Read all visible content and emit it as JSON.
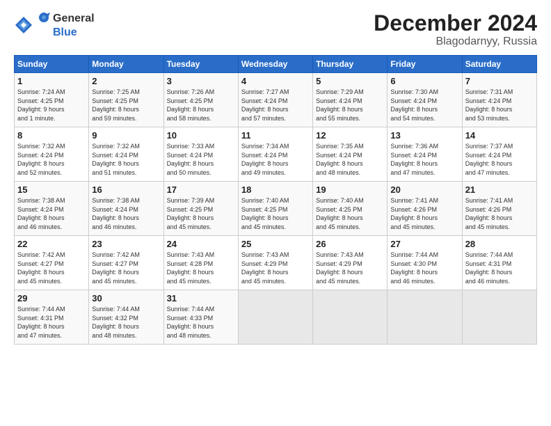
{
  "logo": {
    "general": "General",
    "blue": "Blue"
  },
  "title": "December 2024",
  "subtitle": "Blagodarnyy, Russia",
  "weekdays": [
    "Sunday",
    "Monday",
    "Tuesday",
    "Wednesday",
    "Thursday",
    "Friday",
    "Saturday"
  ],
  "weeks": [
    [
      {
        "day": "1",
        "info": "Sunrise: 7:24 AM\nSunset: 4:25 PM\nDaylight: 9 hours\nand 1 minute."
      },
      {
        "day": "2",
        "info": "Sunrise: 7:25 AM\nSunset: 4:25 PM\nDaylight: 8 hours\nand 59 minutes."
      },
      {
        "day": "3",
        "info": "Sunrise: 7:26 AM\nSunset: 4:25 PM\nDaylight: 8 hours\nand 58 minutes."
      },
      {
        "day": "4",
        "info": "Sunrise: 7:27 AM\nSunset: 4:24 PM\nDaylight: 8 hours\nand 57 minutes."
      },
      {
        "day": "5",
        "info": "Sunrise: 7:29 AM\nSunset: 4:24 PM\nDaylight: 8 hours\nand 55 minutes."
      },
      {
        "day": "6",
        "info": "Sunrise: 7:30 AM\nSunset: 4:24 PM\nDaylight: 8 hours\nand 54 minutes."
      },
      {
        "day": "7",
        "info": "Sunrise: 7:31 AM\nSunset: 4:24 PM\nDaylight: 8 hours\nand 53 minutes."
      }
    ],
    [
      {
        "day": "8",
        "info": "Sunrise: 7:32 AM\nSunset: 4:24 PM\nDaylight: 8 hours\nand 52 minutes."
      },
      {
        "day": "9",
        "info": "Sunrise: 7:32 AM\nSunset: 4:24 PM\nDaylight: 8 hours\nand 51 minutes."
      },
      {
        "day": "10",
        "info": "Sunrise: 7:33 AM\nSunset: 4:24 PM\nDaylight: 8 hours\nand 50 minutes."
      },
      {
        "day": "11",
        "info": "Sunrise: 7:34 AM\nSunset: 4:24 PM\nDaylight: 8 hours\nand 49 minutes."
      },
      {
        "day": "12",
        "info": "Sunrise: 7:35 AM\nSunset: 4:24 PM\nDaylight: 8 hours\nand 48 minutes."
      },
      {
        "day": "13",
        "info": "Sunrise: 7:36 AM\nSunset: 4:24 PM\nDaylight: 8 hours\nand 47 minutes."
      },
      {
        "day": "14",
        "info": "Sunrise: 7:37 AM\nSunset: 4:24 PM\nDaylight: 8 hours\nand 47 minutes."
      }
    ],
    [
      {
        "day": "15",
        "info": "Sunrise: 7:38 AM\nSunset: 4:24 PM\nDaylight: 8 hours\nand 46 minutes."
      },
      {
        "day": "16",
        "info": "Sunrise: 7:38 AM\nSunset: 4:24 PM\nDaylight: 8 hours\nand 46 minutes."
      },
      {
        "day": "17",
        "info": "Sunrise: 7:39 AM\nSunset: 4:25 PM\nDaylight: 8 hours\nand 45 minutes."
      },
      {
        "day": "18",
        "info": "Sunrise: 7:40 AM\nSunset: 4:25 PM\nDaylight: 8 hours\nand 45 minutes."
      },
      {
        "day": "19",
        "info": "Sunrise: 7:40 AM\nSunset: 4:25 PM\nDaylight: 8 hours\nand 45 minutes."
      },
      {
        "day": "20",
        "info": "Sunrise: 7:41 AM\nSunset: 4:26 PM\nDaylight: 8 hours\nand 45 minutes."
      },
      {
        "day": "21",
        "info": "Sunrise: 7:41 AM\nSunset: 4:26 PM\nDaylight: 8 hours\nand 45 minutes."
      }
    ],
    [
      {
        "day": "22",
        "info": "Sunrise: 7:42 AM\nSunset: 4:27 PM\nDaylight: 8 hours\nand 45 minutes."
      },
      {
        "day": "23",
        "info": "Sunrise: 7:42 AM\nSunset: 4:27 PM\nDaylight: 8 hours\nand 45 minutes."
      },
      {
        "day": "24",
        "info": "Sunrise: 7:43 AM\nSunset: 4:28 PM\nDaylight: 8 hours\nand 45 minutes."
      },
      {
        "day": "25",
        "info": "Sunrise: 7:43 AM\nSunset: 4:29 PM\nDaylight: 8 hours\nand 45 minutes."
      },
      {
        "day": "26",
        "info": "Sunrise: 7:43 AM\nSunset: 4:29 PM\nDaylight: 8 hours\nand 45 minutes."
      },
      {
        "day": "27",
        "info": "Sunrise: 7:44 AM\nSunset: 4:30 PM\nDaylight: 8 hours\nand 46 minutes."
      },
      {
        "day": "28",
        "info": "Sunrise: 7:44 AM\nSunset: 4:31 PM\nDaylight: 8 hours\nand 46 minutes."
      }
    ],
    [
      {
        "day": "29",
        "info": "Sunrise: 7:44 AM\nSunset: 4:31 PM\nDaylight: 8 hours\nand 47 minutes."
      },
      {
        "day": "30",
        "info": "Sunrise: 7:44 AM\nSunset: 4:32 PM\nDaylight: 8 hours\nand 48 minutes."
      },
      {
        "day": "31",
        "info": "Sunrise: 7:44 AM\nSunset: 4:33 PM\nDaylight: 8 hours\nand 48 minutes."
      },
      {
        "day": "",
        "info": ""
      },
      {
        "day": "",
        "info": ""
      },
      {
        "day": "",
        "info": ""
      },
      {
        "day": "",
        "info": ""
      }
    ]
  ]
}
